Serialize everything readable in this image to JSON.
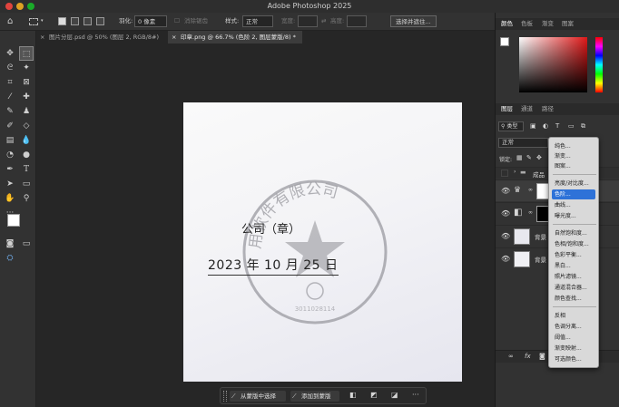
{
  "titlebar": {
    "title": "Adobe Photoshop 2025"
  },
  "options_bar": {
    "feather_label": "羽化:",
    "feather_value": "0 像素",
    "antialias_label": "消除锯齿",
    "style_label": "样式:",
    "style_value": "正常",
    "width_label": "宽度:",
    "height_label": "高度:",
    "select_mask_button": "选择并遮住..."
  },
  "tabs": [
    {
      "label": "图片分层.psd @ 50% (图层 2, RGB/8#)",
      "close": "×"
    },
    {
      "label": "印章.png @ 66.7% (色阶 2, 图层蒙版/8) *",
      "close": "×"
    }
  ],
  "document": {
    "company_text": "公司（章）",
    "date_text": "2023 年 10 月 25 日",
    "stamp_arc_text": "用软件有限公司",
    "stamp_number": "3011028114"
  },
  "contextual_bar": {
    "btn_subtract": "从蒙版中选择",
    "btn_add": "添加到蒙版",
    "more": "···"
  },
  "right_panel": {
    "color_tabs": [
      "颜色",
      "色板",
      "渐变",
      "图案"
    ],
    "layers_tabs": [
      "图层",
      "通道",
      "路径"
    ],
    "search_kind": "类型",
    "blend_mode": "正常",
    "lock_label": "锁定:",
    "group_name": "成品",
    "layers": [
      {
        "name": ""
      },
      {
        "name": ""
      },
      {
        "name": "背景"
      },
      {
        "name": "背景"
      }
    ],
    "fx": "fx"
  },
  "adjust_menu": {
    "group1": [
      "纯色...",
      "渐变...",
      "图案..."
    ],
    "group2": [
      "亮度/对比度...",
      "色阶...",
      "曲线...",
      "曝光度..."
    ],
    "group3": [
      "自然饱和度...",
      "色相/饱和度...",
      "色彩平衡...",
      "黑白...",
      "照片滤镜...",
      "通道混合器...",
      "颜色查找..."
    ],
    "group4": [
      "反相",
      "色调分离...",
      "阈值...",
      "渐变映射...",
      "可选颜色..."
    ],
    "selected": "色阶..."
  },
  "colors": {
    "accent": "#2e72d8",
    "stamp": "#9a9aa0"
  }
}
